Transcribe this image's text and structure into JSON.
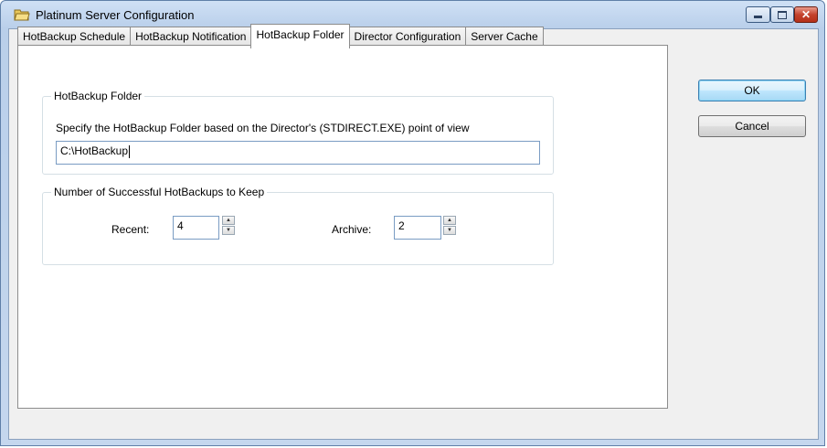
{
  "window": {
    "title": "Platinum Server Configuration"
  },
  "tabs": [
    {
      "label": "HotBackup Schedule"
    },
    {
      "label": "HotBackup Notification"
    },
    {
      "label": "HotBackup Folder"
    },
    {
      "label": "Director Configuration"
    },
    {
      "label": "Server Cache"
    }
  ],
  "active_tab": "HotBackup Folder",
  "folder_group": {
    "title": "HotBackup Folder",
    "description": "Specify the HotBackup Folder based on the Director's (STDIRECT.EXE) point of view",
    "value": "C:\\HotBackup"
  },
  "keep_group": {
    "title": "Number of Successful HotBackups to Keep",
    "recent_label": "Recent:",
    "recent_value": "4",
    "archive_label": "Archive:",
    "archive_value": "2"
  },
  "buttons": {
    "ok": "OK",
    "cancel": "Cancel"
  }
}
